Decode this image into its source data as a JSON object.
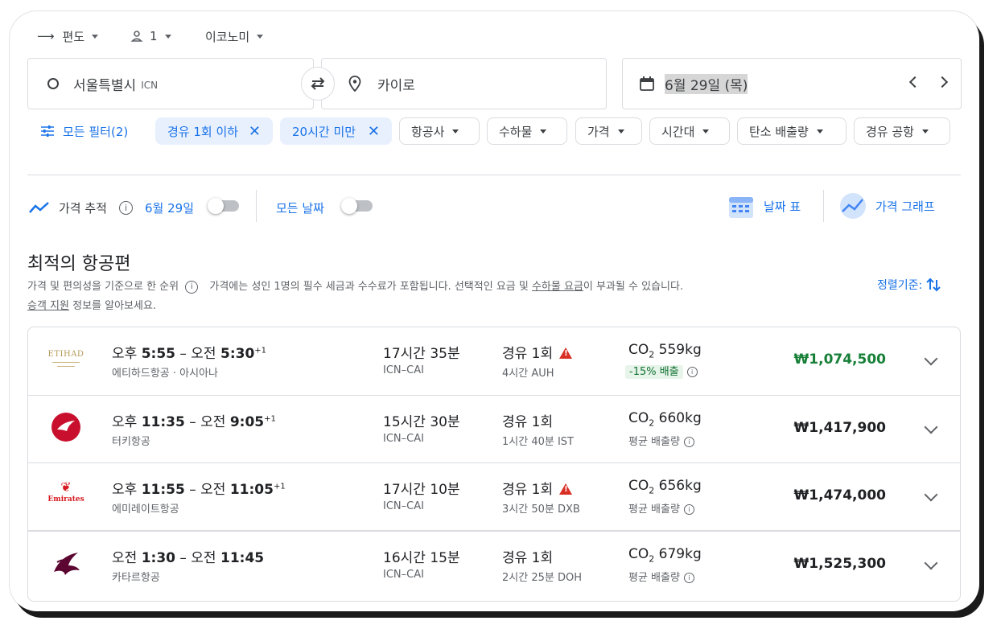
{
  "top": {
    "trip_type": "편도",
    "passengers": "1",
    "cabin": "이코노미"
  },
  "search": {
    "origin": "서울특별시",
    "origin_code": "ICN",
    "destination": "카이로",
    "date": "6월 29일 (목)"
  },
  "filters": {
    "all_filters": "모든 필터(2)",
    "active": [
      "경유 1회 이하",
      "20시간 미만"
    ],
    "dropdowns": [
      "항공사",
      "수하물",
      "가격",
      "시간대",
      "탄소 배출량",
      "경유 공항"
    ]
  },
  "tools": {
    "price_track": "가격 추적",
    "track_date": "6월 29일",
    "all_dates": "모든 날짜",
    "date_grid": "날짜 표",
    "price_graph": "가격 그래프"
  },
  "results": {
    "heading": "최적의 항공편",
    "note1": "가격 및 편의성을 기준으로 한 순위",
    "note2a": "가격에는 성인 1명의 필수 세금과 수수료가 포함됩니다. 선택적인 요금 및 ",
    "note2_link": "수하물 요금",
    "note2b": "이 부과될 수 있습니다.",
    "note3_link": "승객 지원",
    "note3": " 정보를 알아보세요.",
    "sort": "정렬기준:"
  },
  "flights": [
    {
      "time_dep_pre": "오후 ",
      "time_dep": "5:55",
      "time_arr_pre": "오전 ",
      "time_arr": "5:30",
      "plus": "+1",
      "airline": "에티하드항공 · 아시아나",
      "duration": "17시간 35분",
      "route": "ICN–CAI",
      "stops": "경유 1회",
      "layover": "4시간 AUH",
      "co2": "559kg",
      "emission_note": "-15% 배출",
      "price": "₩1,074,500",
      "price_color": "#188038",
      "warn": true,
      "logo": "etihad-logo"
    },
    {
      "time_dep_pre": "오후 ",
      "time_dep": "11:35",
      "time_arr_pre": "오전 ",
      "time_arr": "9:05",
      "plus": "+1",
      "airline": "터키항공",
      "duration": "15시간 30분",
      "route": "ICN–CAI",
      "stops": "경유 1회",
      "layover": "1시간 40분 IST",
      "co2": "660kg",
      "emission_note": "평균 배출량",
      "price": "₩1,417,900",
      "price_color": "#202124",
      "warn": false,
      "logo": "turkish-logo"
    },
    {
      "time_dep_pre": "오후 ",
      "time_dep": "11:55",
      "time_arr_pre": "오전 ",
      "time_arr": "11:05",
      "plus": "+1",
      "airline": "에미레이트항공",
      "duration": "17시간 10분",
      "route": "ICN–CAI",
      "stops": "경유 1회",
      "layover": "3시간 50분 DXB",
      "co2": "656kg",
      "emission_note": "평균 배출량",
      "price": "₩1,474,000",
      "price_color": "#202124",
      "warn": true,
      "logo": "emirates-logo"
    },
    {
      "time_dep_pre": "오전 ",
      "time_dep": "1:30",
      "time_arr_pre": "오전 ",
      "time_arr": "11:45",
      "plus": "",
      "airline": "카타르항공",
      "duration": "16시간 15분",
      "route": "ICN–CAI",
      "stops": "경유 1회",
      "layover": "2시간 25분 DOH",
      "co2": "679kg",
      "emission_note": "평균 배출량",
      "price": "₩1,525,300",
      "price_color": "#202124",
      "warn": false,
      "logo": "qatar-logo"
    }
  ],
  "logo_text": {
    "etihad": "ETIHAD",
    "emirates": "Emirates"
  }
}
